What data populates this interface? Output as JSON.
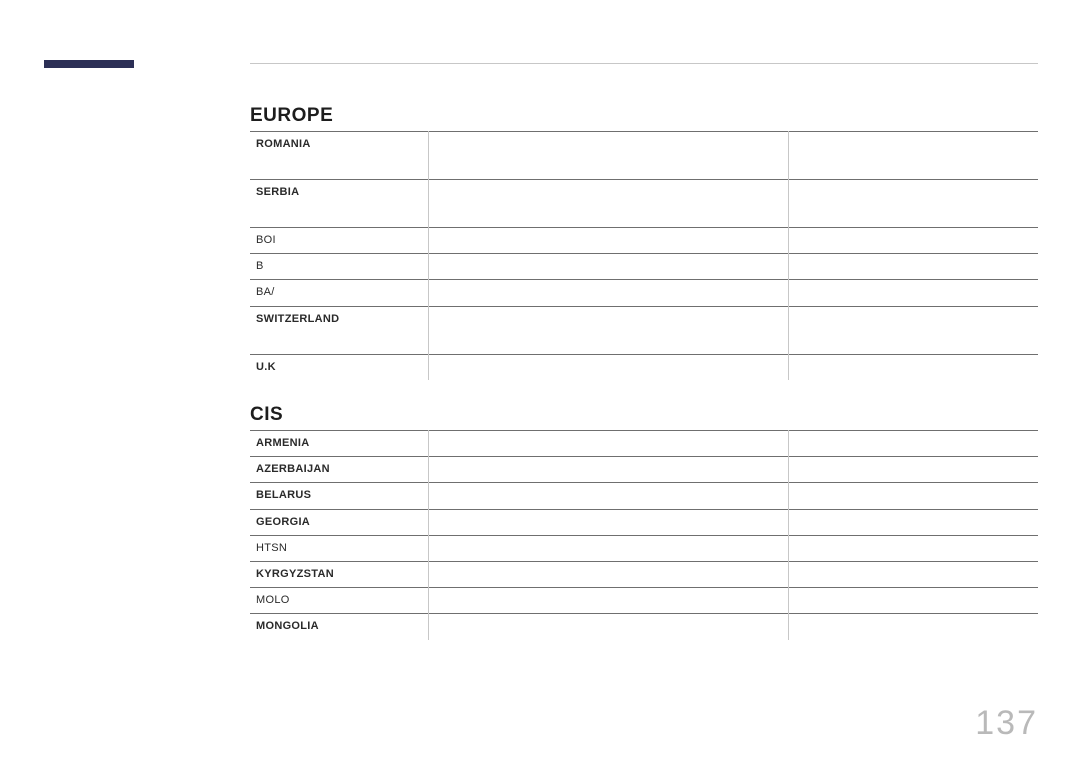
{
  "page_number": "137",
  "sections": [
    {
      "title": "EUROPE",
      "rows": [
        {
          "label": "ROMANIA",
          "weight": "bold",
          "height": "tall"
        },
        {
          "label": "SERBIA",
          "weight": "bold",
          "height": "tall"
        },
        {
          "label": "BOI",
          "weight": "light",
          "height": "short"
        },
        {
          "label": "B",
          "weight": "light",
          "height": "short"
        },
        {
          "label": "BA/",
          "weight": "light",
          "height": "short"
        },
        {
          "label": "SWITZERLAND",
          "weight": "bold",
          "height": "tall"
        },
        {
          "label": "U.K",
          "weight": "bold",
          "height": "short"
        }
      ]
    },
    {
      "title": "CIS",
      "rows": [
        {
          "label": "ARMENIA",
          "weight": "bold",
          "height": "short"
        },
        {
          "label": "AZERBAIJAN",
          "weight": "bold",
          "height": "short"
        },
        {
          "label": "BELARUS",
          "weight": "bold",
          "height": "short"
        },
        {
          "label": "GEORGIA",
          "weight": "bold",
          "height": "short"
        },
        {
          "label": "HTSN",
          "weight": "light",
          "height": "short"
        },
        {
          "label": "KYRGYZSTAN",
          "weight": "bold",
          "height": "short"
        },
        {
          "label": "MOLO",
          "weight": "light",
          "height": "short"
        },
        {
          "label": "MONGOLIA",
          "weight": "bold",
          "height": "short"
        }
      ]
    }
  ]
}
